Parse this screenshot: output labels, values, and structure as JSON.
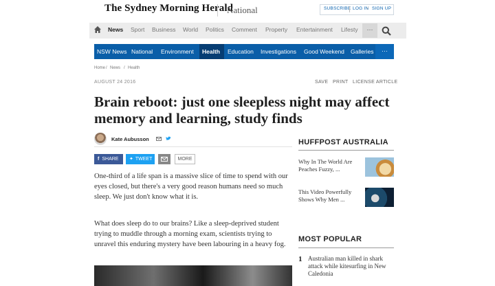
{
  "masthead": {
    "logo": "The Sydney Morning Herald",
    "section": "National",
    "subscribe": "SUBSCRIBE",
    "login": "LOG IN",
    "signup": "SIGN UP"
  },
  "topnav": {
    "items": [
      "News",
      "Sport",
      "Business",
      "World",
      "Politics",
      "Comment",
      "Property",
      "Entertainment",
      "Lifesty"
    ],
    "active": "News",
    "more": "···"
  },
  "subnav": {
    "items": [
      "NSW News",
      "National",
      "Environment",
      "Health",
      "Education",
      "Investigations",
      "Good Weekend",
      "Galleries"
    ],
    "active": "Health",
    "more": "···"
  },
  "breadcrumb": [
    "Home",
    "News",
    "Health"
  ],
  "article": {
    "date": "AUGUST 24 2016",
    "tools": [
      "SAVE",
      "PRINT",
      "LICENSE ARTICLE"
    ],
    "headline": "Brain reboot: just one sleepless night may affect memory and learning, study finds",
    "author": "Kate Aubusson",
    "share": {
      "facebook": "SHARE",
      "twitter": "TWEET",
      "more": "MORE"
    },
    "paragraphs": [
      "One-third of a life span is a massive slice of time to spend with our eyes closed, but there's a very good reason humans need so much sleep. We just don't know what it is.",
      "What does sleep do to our brains? Like a sleep-deprived student trying to muddle through a morning exam, scientists trying to unravel this enduring mystery have been labouring in a heavy fog."
    ]
  },
  "sidebar": {
    "huffpost_title": "HUFFPOST AUSTRALIA",
    "huffpost_items": [
      {
        "text": "Why In The World Are Peaches Fuzzy, ..."
      },
      {
        "text": "This Video Powerfully Shows Why Men ..."
      }
    ],
    "popular_title": "MOST POPULAR",
    "popular_items": [
      {
        "num": "1",
        "text": "Australian man killed in shark attack while kitesurfing in New Caledonia"
      }
    ]
  },
  "colors": {
    "brand_blue": "#0a5ea8",
    "facebook": "#3b5998",
    "twitter": "#1da1f2"
  }
}
